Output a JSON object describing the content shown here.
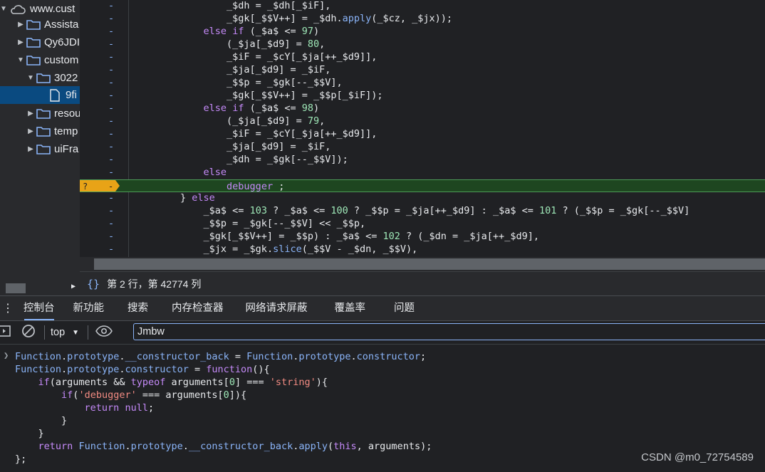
{
  "sidebar": {
    "items": [
      {
        "label": "www.cust",
        "icon": "cloud-icon",
        "expanded": true
      },
      {
        "label": "Assista",
        "icon": "folder-icon",
        "expanded": false
      },
      {
        "label": "Qy6JDI",
        "icon": "folder-icon",
        "expanded": false
      },
      {
        "label": "custom",
        "icon": "folder-icon",
        "expanded": true
      },
      {
        "label": "3022",
        "icon": "folder-icon",
        "expanded": true
      },
      {
        "label": "9fi",
        "icon": "file-icon",
        "selected": true
      },
      {
        "label": "resou",
        "icon": "folder-icon",
        "expanded": false
      },
      {
        "label": "temp",
        "icon": "folder-icon",
        "expanded": false
      },
      {
        "label": "uiFra",
        "icon": "folder-icon",
        "expanded": false
      }
    ]
  },
  "editor": {
    "gutter_mark": "-",
    "breakpoint_label": "?",
    "lines": [
      "                _$dh = _$dh[_$iF],",
      "                _$gk[_$$V++] = _$dh.apply(_$cz, _$jx));",
      "            else if (_$a$ <= 97)",
      "                (_$ja[_$d9] = 80,",
      "                _$iF = _$cY[_$ja[++_$d9]],",
      "                _$ja[_$d9] = _$iF,",
      "                _$$p = _$gk[--_$$V],",
      "                _$gk[_$$V++] = _$$p[_$iF]);",
      "            else if (_$a$ <= 98)",
      "                (_$ja[_$d9] = 79,",
      "                _$iF = _$cY[_$ja[++_$d9]],",
      "                _$ja[_$d9] = _$iF,",
      "                _$dh = _$gk[--_$$V]);",
      "            else",
      "                debugger ;",
      "        } else",
      "            _$a$ <= 103 ? _$a$ <= 100 ? _$$p = _$ja[++_$d9] : _$a$ <= 101 ? (_$$p = _$gk[--_$$V]",
      "            _$$p = _$gk[--_$$V] << _$$p,",
      "            _$gk[_$$V++] = _$$p) : _$a$ <= 102 ? (_$dn = _$ja[++_$d9],",
      "            _$jx = _$gk.slice(_$$V - _$dn, _$$V),"
    ],
    "breakpoint_line_index": 14
  },
  "status": {
    "position": "第 2 行，第 42774 列"
  },
  "drawer": {
    "tabs": [
      "控制台",
      "新功能",
      "搜索",
      "内存检查器",
      "网络请求屏蔽",
      "覆盖率",
      "问题"
    ],
    "active_tab": "控制台"
  },
  "console_toolbar": {
    "context": "top",
    "filter_value": "Jmbw"
  },
  "console": {
    "lines": [
      "Function.prototype.__constructor_back = Function.prototype.constructor;",
      "Function.prototype.constructor = function(){",
      "    if(arguments && typeof arguments[0] === 'string'){",
      "        if('debugger' === arguments[0]){",
      "            return null;",
      "        }",
      "    }",
      "    return Function.prototype.__constructor_back.apply(this, arguments);",
      "};"
    ]
  },
  "watermark": "CSDN @m0_72754589",
  "colors": {
    "keyword": "#c58af9",
    "number": "#9ee7b7",
    "function": "#8ab4f8",
    "string": "#f28b82",
    "breakpoint": "#e8a317",
    "selection": "#0a4a80"
  }
}
